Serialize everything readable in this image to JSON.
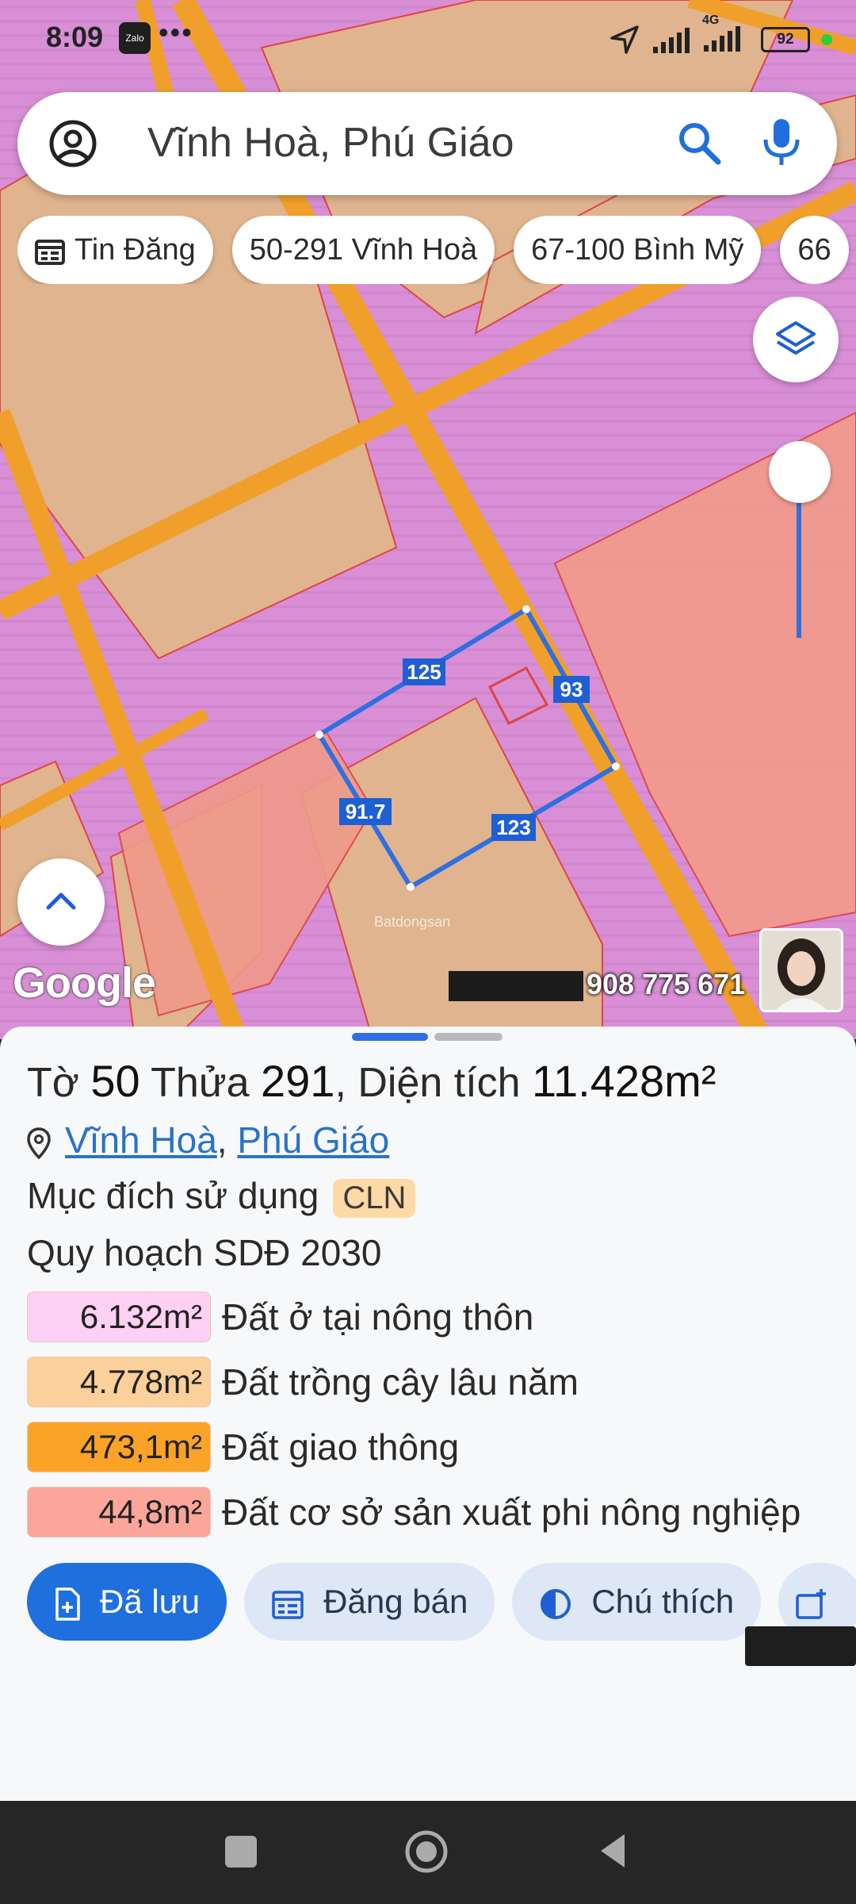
{
  "status_bar": {
    "time": "8:09",
    "app_badge": "Zalo",
    "more": "•••",
    "network": "4G",
    "battery": "92"
  },
  "search": {
    "query": "Vĩnh Hoà, Phú Giáo",
    "icons": [
      "account-icon",
      "search-icon",
      "mic-icon"
    ]
  },
  "chips": [
    {
      "label": "Tin Đăng",
      "icon": "calendar-icon"
    },
    {
      "label": "50-291 Vĩnh Hoà"
    },
    {
      "label": "67-100 Bình Mỹ"
    },
    {
      "label": "66"
    }
  ],
  "map": {
    "parcel_edges": [
      "125",
      "93",
      "123",
      "91.7"
    ],
    "google_logo": "Google",
    "watermark_phone": "908 775 671",
    "brand": "Batdongsan"
  },
  "parcel": {
    "title_prefix": "Tờ",
    "sheet_no": "50",
    "plot_label": "Thửa",
    "plot_no": "291",
    "area_label": ", Diện tích",
    "area": "11.428m²",
    "ward": "Vĩnh Hoà",
    "sep": ",",
    "district": "Phú Giáo",
    "purpose_label": "Mục đích sử dụng",
    "purpose_code": "CLN",
    "plan_label": "Quy hoạch SDĐ 2030"
  },
  "land_use": [
    {
      "value": "6.132m²",
      "label": "Đất ở tại nông thôn",
      "color": "#fdd0f4"
    },
    {
      "value": "4.778m²",
      "label": "Đất trồng cây lâu năm",
      "color": "#fcd09a"
    },
    {
      "value": "473,1m²",
      "label": "Đất giao thông",
      "color": "#fba327"
    },
    {
      "value": "44,8m²",
      "label": "Đất cơ sở sản xuất phi nông nghiệp",
      "color": "#fca69b"
    }
  ],
  "actions": {
    "saved": "Đã lưu",
    "post_sale": "Đăng bán",
    "legend": "Chú thích"
  },
  "colors": {
    "primary": "#1f6fde",
    "secondary_bg": "#dde7f5",
    "road": "#f2a22b",
    "residential": "#d999e4",
    "perennial": "#e7b98c"
  }
}
